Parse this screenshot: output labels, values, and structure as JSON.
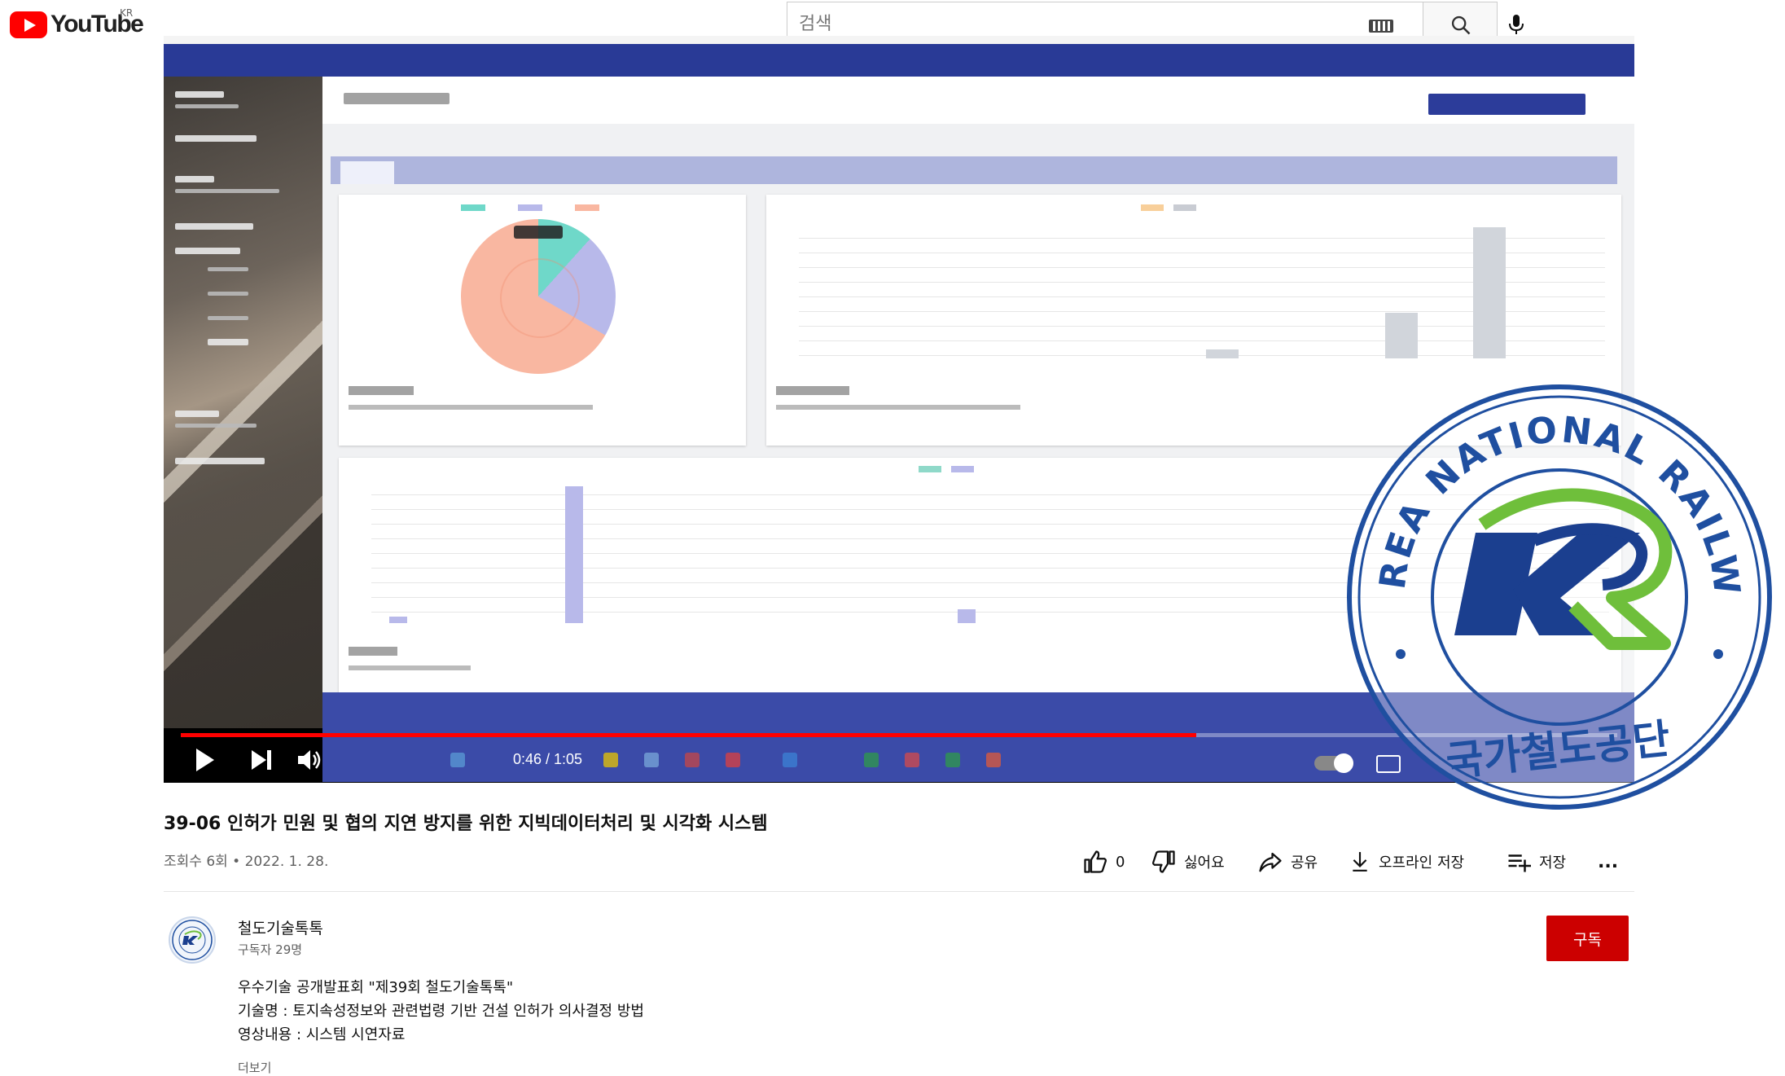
{
  "masthead": {
    "logo_text": "YouTube",
    "region": "KR",
    "search": {
      "placeholder": "검색",
      "value": ""
    }
  },
  "player": {
    "current_time": "0:46",
    "duration": "1:05",
    "time_display": "0:46 / 1:05",
    "progress_fraction": 0.707,
    "autoplay_on": true
  },
  "stamp": {
    "outer_text": "KOREA NATIONAL RAILWAY",
    "inner_text": "국가철도공단",
    "logo_letters": "KR",
    "colors": {
      "ring": "#1f4fa0",
      "navy": "#1b3f8f",
      "green": "#6fbf3b"
    }
  },
  "video": {
    "title": "39-06 인허가 민원 및 협의 지연 방지를 위한 지빅데이터처리 및 시각화 시스템",
    "meta": "조회수 6회 • 2022. 1. 28."
  },
  "actions": {
    "like_count": "0",
    "dislike_label": "싫어요",
    "share_label": "공유",
    "download_label": "오프라인 저장",
    "save_label": "저장",
    "more_label": "..."
  },
  "channel": {
    "name": "철도기술톡톡",
    "subscribers": "구독자 29명",
    "subscribe_label": "구독"
  },
  "description": {
    "lines": [
      "우수기술 공개발표회 \"제39회 철도기술톡톡\"",
      "기술명 : 토지속성정보와 관련법령 기반 건설 인허가 의사결정 방법",
      "영상내용 : 시스템 시연자료"
    ],
    "more_label": "더보기"
  },
  "colors": {
    "brand_red": "#ff0000",
    "subscribe_red": "#cc0000",
    "app_navy": "#293a96"
  }
}
